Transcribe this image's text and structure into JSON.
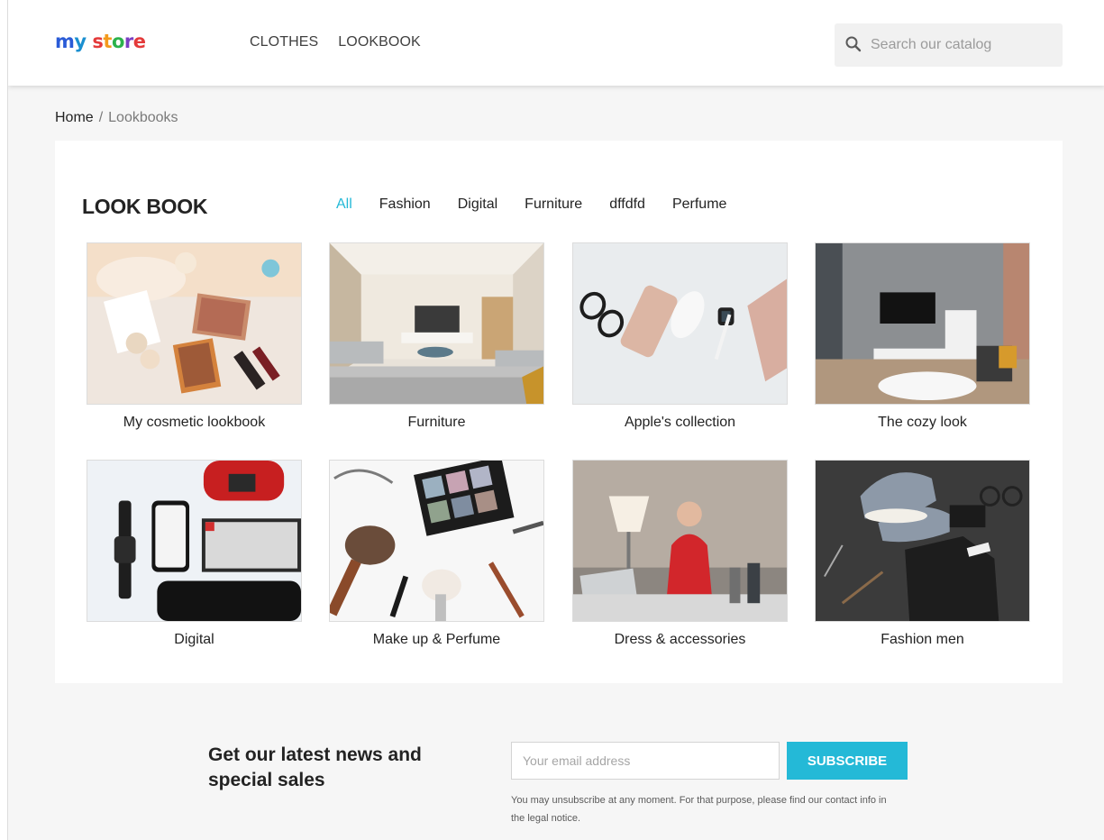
{
  "header": {
    "logo_parts": [
      "m",
      "y",
      " s",
      "t",
      "o",
      "r",
      "e"
    ],
    "nav": [
      "CLOTHES",
      "LOOKBOOK"
    ],
    "search_placeholder": "Search our catalog"
  },
  "breadcrumb": {
    "home": "Home",
    "separator": "/",
    "current": "Lookbooks"
  },
  "lookbook": {
    "title": "LOOK BOOK",
    "filters": [
      "All",
      "Fashion",
      "Digital",
      "Furniture",
      "dffdfd",
      "Perfume"
    ],
    "active_filter": "All",
    "items": [
      {
        "caption": "My cosmetic lookbook"
      },
      {
        "caption": "Furniture"
      },
      {
        "caption": "Apple's collection"
      },
      {
        "caption": "The cozy look"
      },
      {
        "caption": "Digital"
      },
      {
        "caption": "Make up & Perfume"
      },
      {
        "caption": "Dress & accessories"
      },
      {
        "caption": "Fashion men"
      }
    ]
  },
  "newsletter": {
    "title": "Get our latest news and special sales",
    "email_placeholder": "Your email address",
    "button": "SUBSCRIBE",
    "note": "You may unsubscribe at any moment. For that purpose, please find our contact info in the legal notice."
  },
  "colors": {
    "accent": "#24b9d7",
    "text": "#232323",
    "background": "#f6f6f6"
  }
}
